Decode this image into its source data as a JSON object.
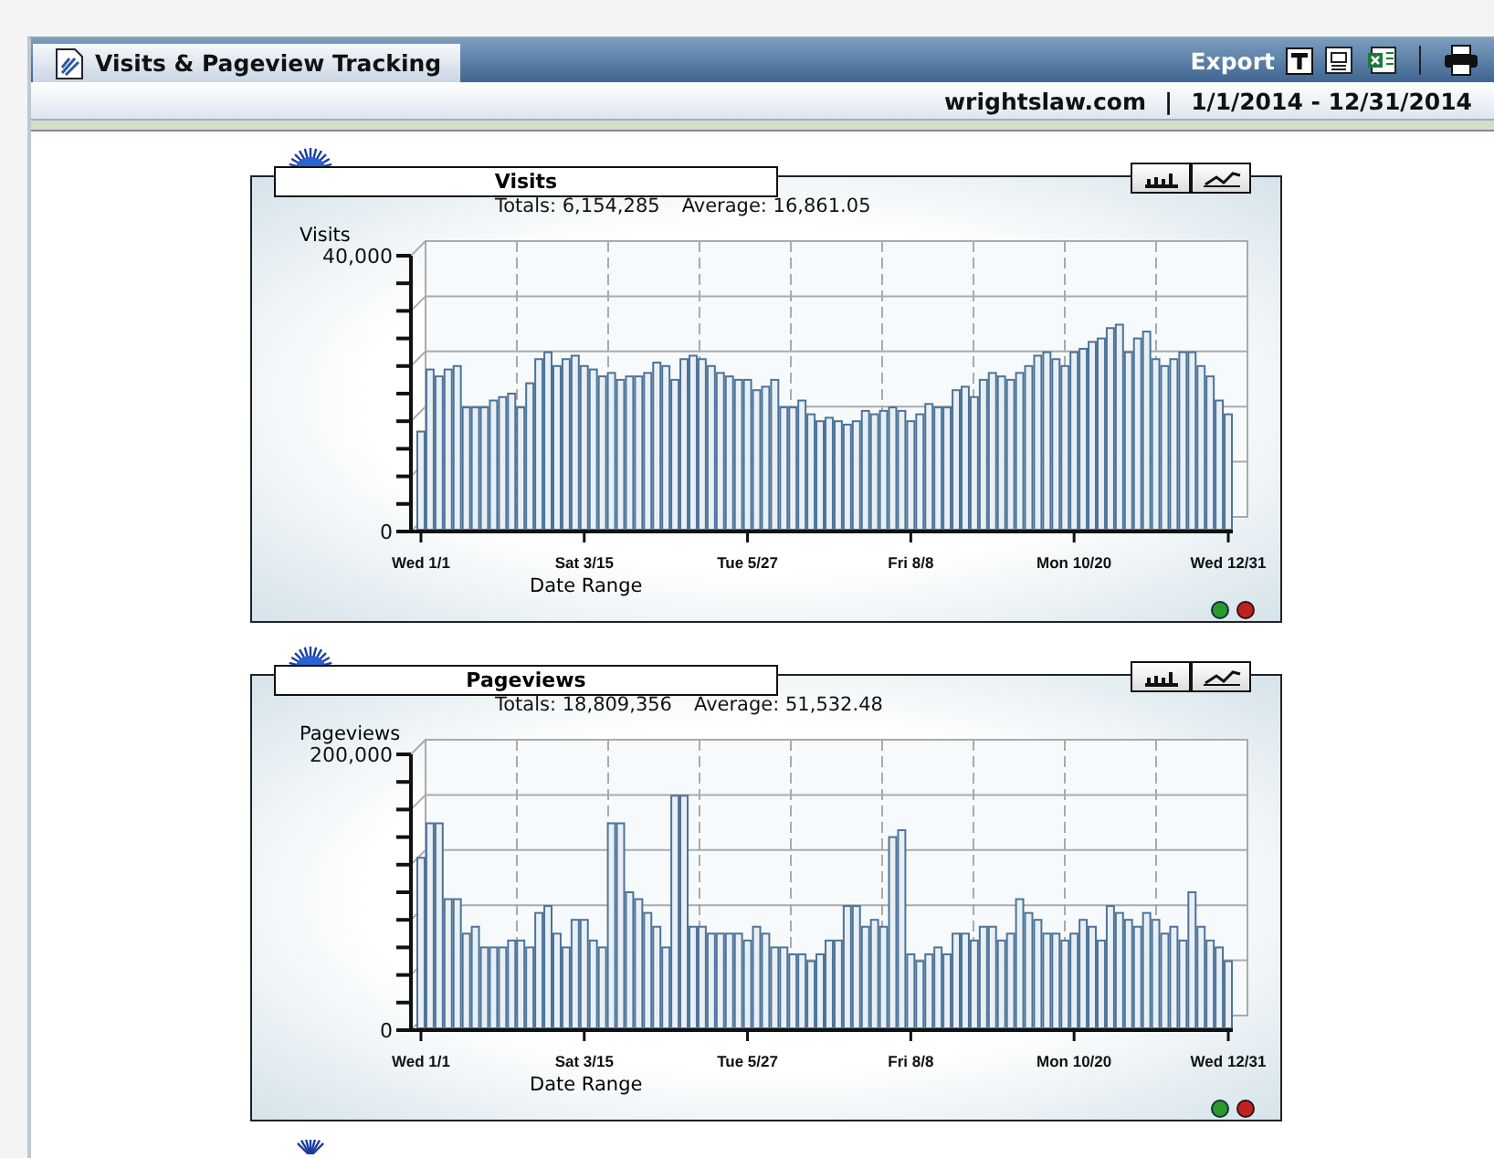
{
  "header": {
    "tab": "Visits & Pageview Tracking",
    "export_label": "Export",
    "site": "wrightslaw.com",
    "separator": "|",
    "date_range": "1/1/2014 - 12/31/2014"
  },
  "charts": [
    {
      "title": "Visits",
      "totals": "Totals: 6,154,285",
      "average": "Average: 16,861.05",
      "chart_data": {
        "type": "bar",
        "grid": true,
        "ylabel": "Visits",
        "xlabel": "Date Range",
        "ylim": [
          0,
          40000
        ],
        "yticks": [
          0,
          {
            "value": 40000,
            "label": "40,000"
          }
        ],
        "categories": [
          "Wed 1/1",
          null,
          null,
          null,
          null,
          null,
          null,
          null,
          null,
          null,
          null,
          null,
          null,
          null,
          null,
          null,
          null,
          null,
          "Sat 3/15",
          null,
          null,
          null,
          null,
          null,
          null,
          null,
          null,
          null,
          null,
          null,
          null,
          null,
          null,
          null,
          null,
          null,
          "Tue 5/27",
          null,
          null,
          null,
          null,
          null,
          null,
          null,
          null,
          null,
          null,
          null,
          null,
          null,
          null,
          null,
          null,
          null,
          "Fri 8/8",
          null,
          null,
          null,
          null,
          null,
          null,
          null,
          null,
          null,
          null,
          null,
          null,
          null,
          null,
          null,
          null,
          null,
          "Mon 10/20",
          null,
          null,
          null,
          null,
          null,
          null,
          null,
          null,
          null,
          null,
          null,
          null,
          null,
          null,
          null,
          null,
          "Wed 12/31"
        ],
        "series": [
          {
            "color": "#4e7397",
            "values": [
              14500,
              23500,
              22500,
              23500,
              24000,
              18000,
              18000,
              18000,
              19000,
              19500,
              20000,
              18000,
              21500,
              25000,
              26000,
              24000,
              25000,
              25500,
              24000,
              23500,
              22500,
              23000,
              22000,
              22500,
              22500,
              23000,
              24500,
              24000,
              22000,
              25000,
              25500,
              25000,
              24000,
              23000,
              22500,
              22000,
              22000,
              20500,
              21000,
              22000,
              18000,
              18000,
              19000,
              17000,
              16000,
              16500,
              16000,
              15500,
              16000,
              17500,
              17000,
              17500,
              18000,
              17500,
              16000,
              17000,
              18500,
              18000,
              18000,
              20500,
              21000,
              19500,
              22000,
              23000,
              22500,
              22000,
              23000,
              24000,
              25500,
              26000,
              25000,
              24000,
              26000,
              26500,
              27500,
              28000,
              29500,
              30000,
              26000,
              28000,
              29000,
              25000,
              24000,
              25000,
              26000,
              26000,
              24000,
              22500,
              19000,
              17000
            ]
          }
        ]
      }
    },
    {
      "title": "Pageviews",
      "totals": "Totals: 18,809,356",
      "average": "Average: 51,532.48",
      "chart_data": {
        "type": "bar",
        "grid": true,
        "ylabel": "Pageviews",
        "xlabel": "Date Range",
        "ylim": [
          0,
          200000
        ],
        "yticks": [
          0,
          {
            "value": 200000,
            "label": "200,000"
          }
        ],
        "categories": [
          "Wed 1/1",
          null,
          null,
          null,
          null,
          null,
          null,
          null,
          null,
          null,
          null,
          null,
          null,
          null,
          null,
          null,
          null,
          null,
          "Sat 3/15",
          null,
          null,
          null,
          null,
          null,
          null,
          null,
          null,
          null,
          null,
          null,
          null,
          null,
          null,
          null,
          null,
          null,
          "Tue 5/27",
          null,
          null,
          null,
          null,
          null,
          null,
          null,
          null,
          null,
          null,
          null,
          null,
          null,
          null,
          null,
          null,
          null,
          "Fri 8/8",
          null,
          null,
          null,
          null,
          null,
          null,
          null,
          null,
          null,
          null,
          null,
          null,
          null,
          null,
          null,
          null,
          null,
          "Mon 10/20",
          null,
          null,
          null,
          null,
          null,
          null,
          null,
          null,
          null,
          null,
          null,
          null,
          null,
          null,
          null,
          null,
          "Wed 12/31"
        ],
        "series": [
          {
            "color": "#4e7397",
            "values": [
              125000,
              150000,
              150000,
              95000,
              95000,
              70000,
              75000,
              60000,
              60000,
              60000,
              65000,
              65000,
              60000,
              85000,
              90000,
              70000,
              60000,
              80000,
              80000,
              65000,
              60000,
              150000,
              150000,
              100000,
              95000,
              85000,
              75000,
              60000,
              170000,
              170000,
              75000,
              75000,
              70000,
              70000,
              70000,
              70000,
              65000,
              75000,
              70000,
              60000,
              60000,
              55000,
              55000,
              50000,
              55000,
              65000,
              65000,
              90000,
              90000,
              75000,
              80000,
              75000,
              140000,
              145000,
              55000,
              50000,
              55000,
              60000,
              55000,
              70000,
              70000,
              65000,
              75000,
              75000,
              65000,
              70000,
              95000,
              85000,
              80000,
              70000,
              70000,
              65000,
              70000,
              80000,
              75000,
              65000,
              90000,
              85000,
              80000,
              75000,
              85000,
              80000,
              70000,
              75000,
              65000,
              100000,
              75000,
              65000,
              60000,
              50000
            ]
          }
        ]
      }
    }
  ]
}
